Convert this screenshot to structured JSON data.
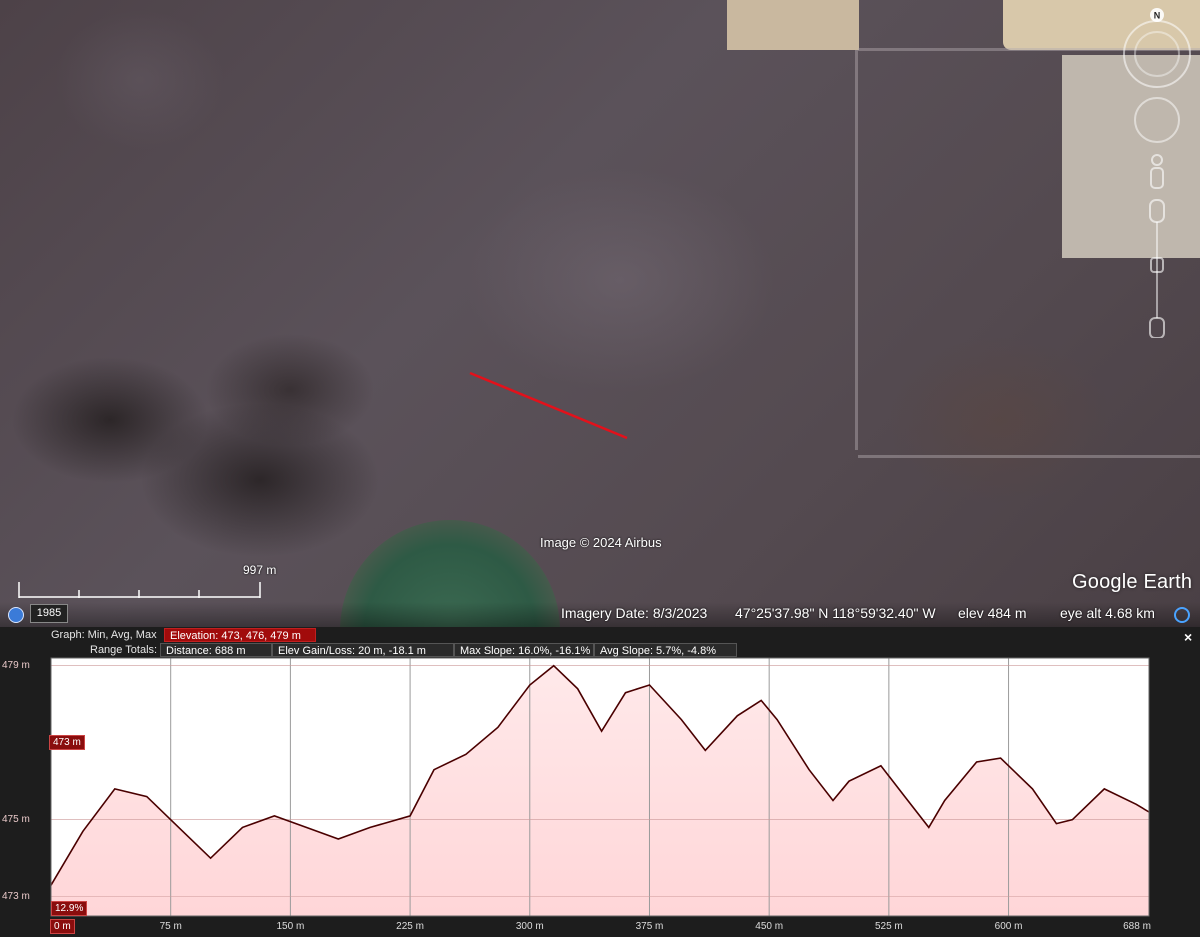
{
  "map": {
    "image_credit": "Image © 2024 Airbus",
    "scale_label": "997 m",
    "logo": "Google Earth",
    "compass_label": "N"
  },
  "status_bar": {
    "year": "1985",
    "imagery_date": "Imagery Date: 8/3/2023",
    "coords": "47°25'37.98\" N   118°59'32.40\" W",
    "elev": "elev   484 m",
    "eye_alt": "eye alt   4.68 km"
  },
  "profile": {
    "close_label": "×",
    "graph_label": "Graph: Min, Avg, Max",
    "elevation_box": "Elevation: 473, 476, 479 m",
    "range_label": "Range Totals:",
    "distance_box": "Distance: 688 m",
    "gain_box": "Elev Gain/Loss: 20 m, -18.1 m",
    "max_slope_box": "Max Slope: 16.0%, -16.1%",
    "avg_slope_box": "Avg Slope: 5.7%, -4.8%",
    "cursor_elev_tag": "473 m",
    "cursor_slope_tag": "12.9%",
    "cursor_dist_tag": "0 m",
    "fill_color": "#ffd6d8",
    "line_color": "#4a0000"
  },
  "chart_data": {
    "type": "area",
    "xlabel": "",
    "ylabel": "",
    "xlim": [
      0,
      688
    ],
    "ylim": [
      472.5,
      479.2
    ],
    "y_ticks": [
      "479 m",
      "475 m",
      "473 m"
    ],
    "y_tick_values": [
      479,
      475,
      473
    ],
    "x_ticks": [
      "75 m",
      "150 m",
      "225 m",
      "300 m",
      "375 m",
      "450 m",
      "525 m",
      "600 m",
      "688 m"
    ],
    "x_tick_values": [
      75,
      150,
      225,
      300,
      375,
      450,
      525,
      600,
      688
    ],
    "series": [
      {
        "x": [
          0,
          20,
          40,
          60,
          80,
          100,
          120,
          140,
          160,
          180,
          200,
          225,
          240,
          260,
          280,
          300,
          315,
          330,
          345,
          360,
          375,
          395,
          410,
          430,
          445,
          455,
          475,
          490,
          500,
          520,
          535,
          550,
          560,
          580,
          595,
          615,
          630,
          640,
          660,
          680,
          688
        ],
        "y": [
          473.3,
          474.7,
          475.8,
          475.6,
          474.8,
          474.0,
          474.8,
          475.1,
          474.8,
          474.5,
          474.8,
          475.1,
          476.3,
          476.7,
          477.4,
          478.5,
          479.0,
          478.4,
          477.3,
          478.3,
          478.5,
          477.6,
          476.8,
          477.7,
          478.1,
          477.6,
          476.3,
          475.5,
          476.0,
          476.4,
          475.6,
          474.8,
          475.5,
          476.5,
          476.6,
          475.8,
          474.9,
          475.0,
          475.8,
          475.4,
          475.2
        ]
      }
    ]
  }
}
